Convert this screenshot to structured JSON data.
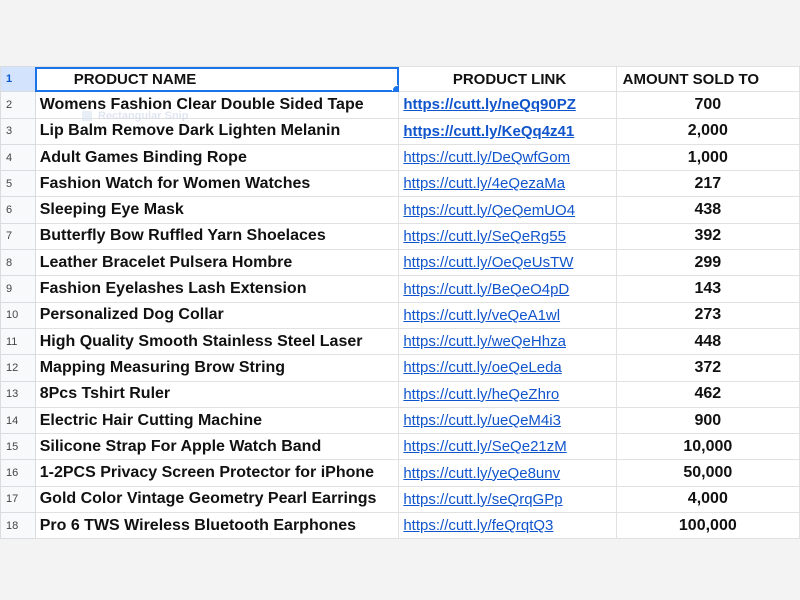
{
  "headers": {
    "row_number": "1",
    "product_name": "PRODUCT NAME",
    "product_link": "PRODUCT LINK",
    "amount_sold": "AMOUNT SOLD TO"
  },
  "ghost_tooltip": "Rectangular Snip",
  "rows": [
    {
      "n": "2",
      "name": "Womens Fashion Clear Double Sided Tape",
      "link": "https://cutt.ly/neQq90PZ",
      "amount": "700"
    },
    {
      "n": "3",
      "name": "Lip Balm Remove Dark Lighten Melanin",
      "link": "https://cutt.ly/KeQq4z41",
      "amount": "2,000"
    },
    {
      "n": "4",
      "name": "Adult Games Binding Rope",
      "link": "https://cutt.ly/DeQwfGom",
      "amount": "1,000"
    },
    {
      "n": "5",
      "name": "Fashion Watch for Women Watches",
      "link": "https://cutt.ly/4eQezaMa",
      "amount": "217"
    },
    {
      "n": "6",
      "name": "Sleeping Eye Mask",
      "link": "https://cutt.ly/QeQemUO4",
      "amount": "438"
    },
    {
      "n": "7",
      "name": "Butterfly Bow Ruffled Yarn Shoelaces",
      "link": "https://cutt.ly/SeQeRg55",
      "amount": "392"
    },
    {
      "n": "8",
      "name": "Leather Bracelet Pulsera Hombre",
      "link": "https://cutt.ly/OeQeUsTW",
      "amount": "299"
    },
    {
      "n": "9",
      "name": "Fashion Eyelashes Lash Extension",
      "link": "https://cutt.ly/BeQeO4pD",
      "amount": "143"
    },
    {
      "n": "10",
      "name": "Personalized Dog Collar",
      "link": "https://cutt.ly/veQeA1wl",
      "amount": "273"
    },
    {
      "n": "11",
      "name": "High Quality Smooth Stainless Steel Laser",
      "link": "https://cutt.ly/weQeHhza",
      "amount": "448"
    },
    {
      "n": "12",
      "name": "Mapping Measuring Brow String",
      "link": "https://cutt.ly/oeQeLeda",
      "amount": "372"
    },
    {
      "n": "13",
      "name": "8Pcs Tshirt Ruler",
      "link": "https://cutt.ly/heQeZhro",
      "amount": "462"
    },
    {
      "n": "14",
      "name": "Electric Hair Cutting Machine",
      "link": "https://cutt.ly/ueQeM4i3",
      "amount": "900"
    },
    {
      "n": "15",
      "name": "Silicone Strap For Apple Watch Band",
      "link": "https://cutt.ly/SeQe21zM",
      "amount": "10,000"
    },
    {
      "n": "16",
      "name": "1-2PCS Privacy Screen Protector for iPhone",
      "link": "https://cutt.ly/yeQe8unv",
      "amount": "50,000"
    },
    {
      "n": "17",
      "name": "Gold Color Vintage Geometry Pearl Earrings",
      "link": "https://cutt.ly/seQrqGPp",
      "amount": "4,000"
    },
    {
      "n": "18",
      "name": "Pro 6 TWS Wireless Bluetooth Earphones",
      "link": "https://cutt.ly/feQrqtQ3",
      "amount": "100,000"
    }
  ],
  "bold_link_rows": [
    0,
    1
  ],
  "colors": {
    "link": "#1155cc",
    "selection": "#1a73e8",
    "header_selected_bg": "#d3e3fd"
  }
}
